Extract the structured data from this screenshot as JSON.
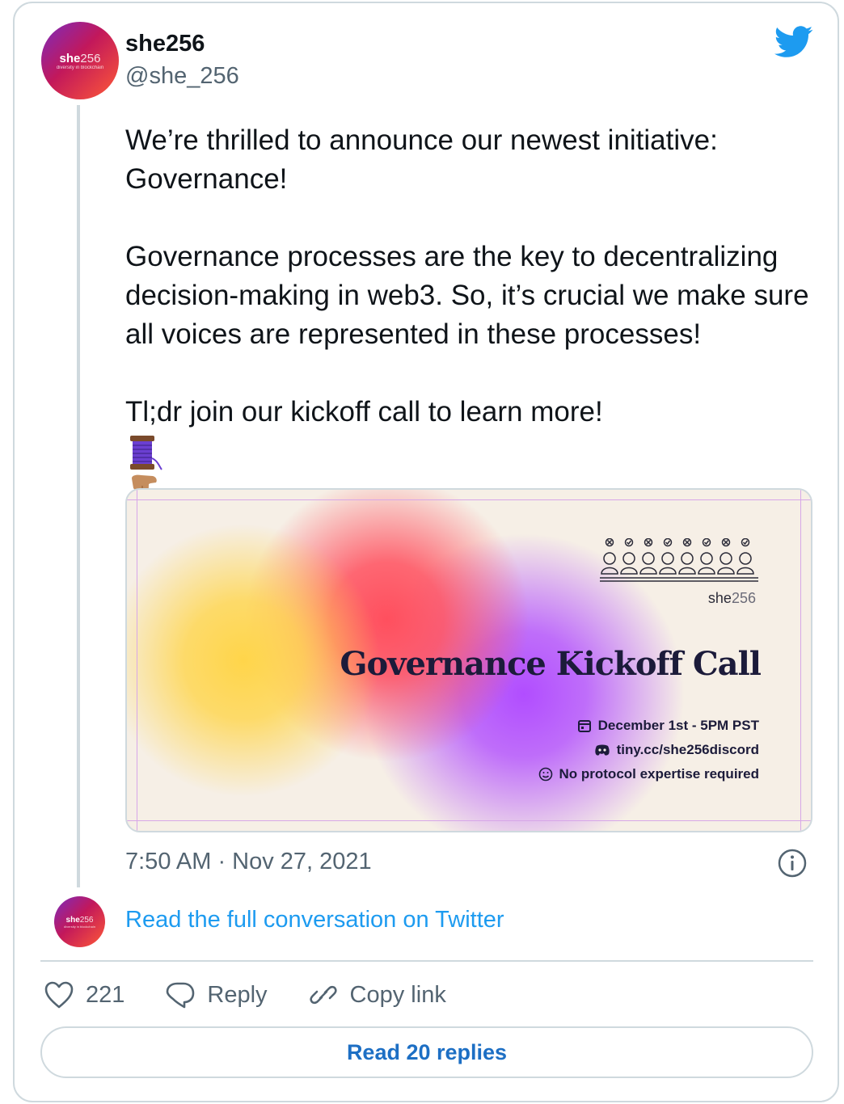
{
  "author": {
    "name": "she256",
    "handle": "@she_256",
    "avatar_brand": "she",
    "avatar_brand_num": "256",
    "avatar_tagline": "diversity in blockchain"
  },
  "tweet": {
    "paragraphs": [
      "We’re thrilled to announce our newest initiative: Governance!",
      "Governance processes are the key to decentralizing decision-making in web3. So, it’s crucial we make sure all voices are represented in these processes!",
      "Tl;dr join our kickoff call to learn more!"
    ],
    "emoji_names": [
      "thread-spool-icon",
      "pointing-down-icon"
    ],
    "timestamp": "7:50 AM · Nov 27, 2021"
  },
  "media": {
    "brand": "she",
    "brand_num": "256",
    "title": "Governance Kickoff Call",
    "details": [
      {
        "icon": "calendar-icon",
        "text": "December 1st - 5PM PST"
      },
      {
        "icon": "discord-icon",
        "text": "tiny.cc/she256discord"
      },
      {
        "icon": "smiley-icon",
        "text": "No protocol expertise required"
      }
    ],
    "colors": {
      "yellow": "#ffd54a",
      "red": "#ff4f5e",
      "purple": "#b14dff",
      "background": "#f6efe6"
    }
  },
  "links": {
    "read_conversation": "Read the full conversation on Twitter"
  },
  "actions": {
    "likes": "221",
    "reply": "Reply",
    "copy_link": "Copy link",
    "read_replies": "Read 20 replies"
  },
  "colors": {
    "accent": "#1d9bf0",
    "muted": "#536471",
    "border": "#cfd9de"
  }
}
